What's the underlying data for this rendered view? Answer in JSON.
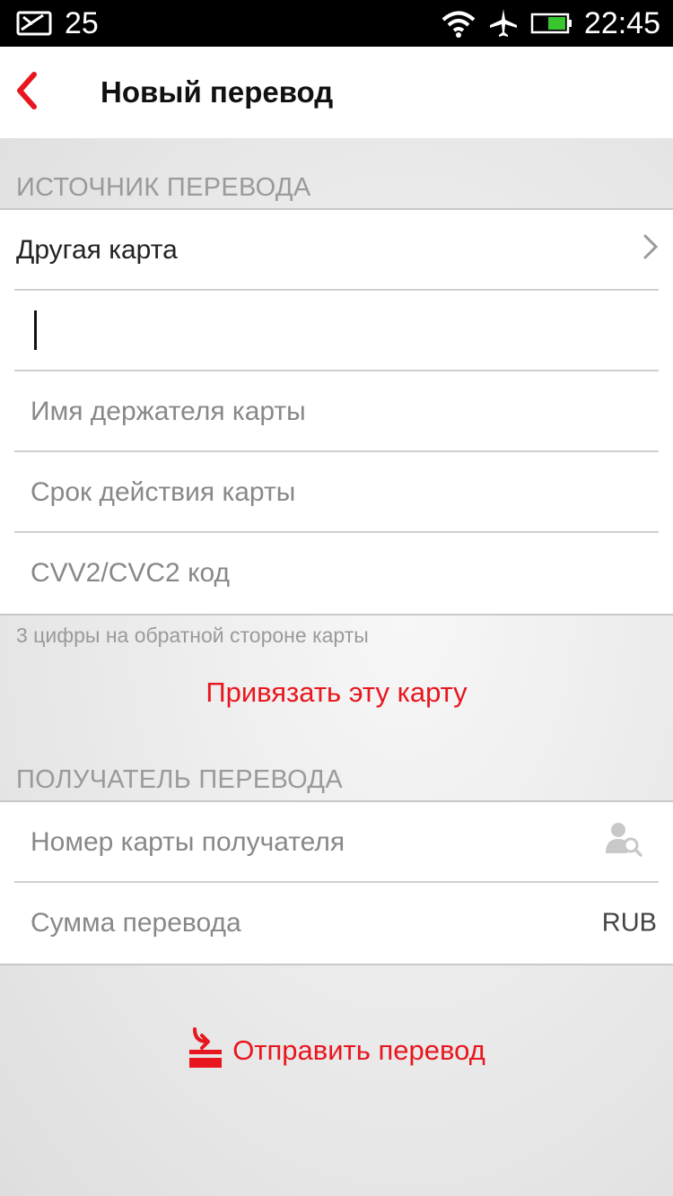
{
  "status_bar": {
    "notification_count": "25",
    "time": "22:45"
  },
  "header": {
    "title": "Новый перевод"
  },
  "source_section": {
    "title": "ИСТОЧНИК ПЕРЕВОДА",
    "card_select_label": "Другая карта",
    "card_number_value": "",
    "cardholder_placeholder": "Имя держателя карты",
    "expiry_placeholder": "Срок действия карты",
    "cvv_placeholder": "CVV2/CVC2 код",
    "cvv_hint": "3 цифры на обратной стороне карты",
    "bind_card_label": "Привязать эту карту"
  },
  "recipient_section": {
    "title": "ПОЛУЧАТЕЛЬ ПЕРЕВОДА",
    "card_number_placeholder": "Номер карты получателя",
    "amount_placeholder": "Сумма перевода",
    "currency": "RUB"
  },
  "actions": {
    "send_label": "Отправить перевод"
  },
  "colors": {
    "accent": "#e8161e",
    "battery": "#38c52d"
  },
  "icons": {
    "notification": "envelope-check-icon",
    "wifi": "wifi-icon",
    "airplane": "airplane-icon",
    "battery": "battery-icon",
    "back": "back-chevron-icon",
    "chevron": "chevron-right-icon",
    "contacts": "contact-search-icon",
    "send": "send-transfer-icon"
  }
}
